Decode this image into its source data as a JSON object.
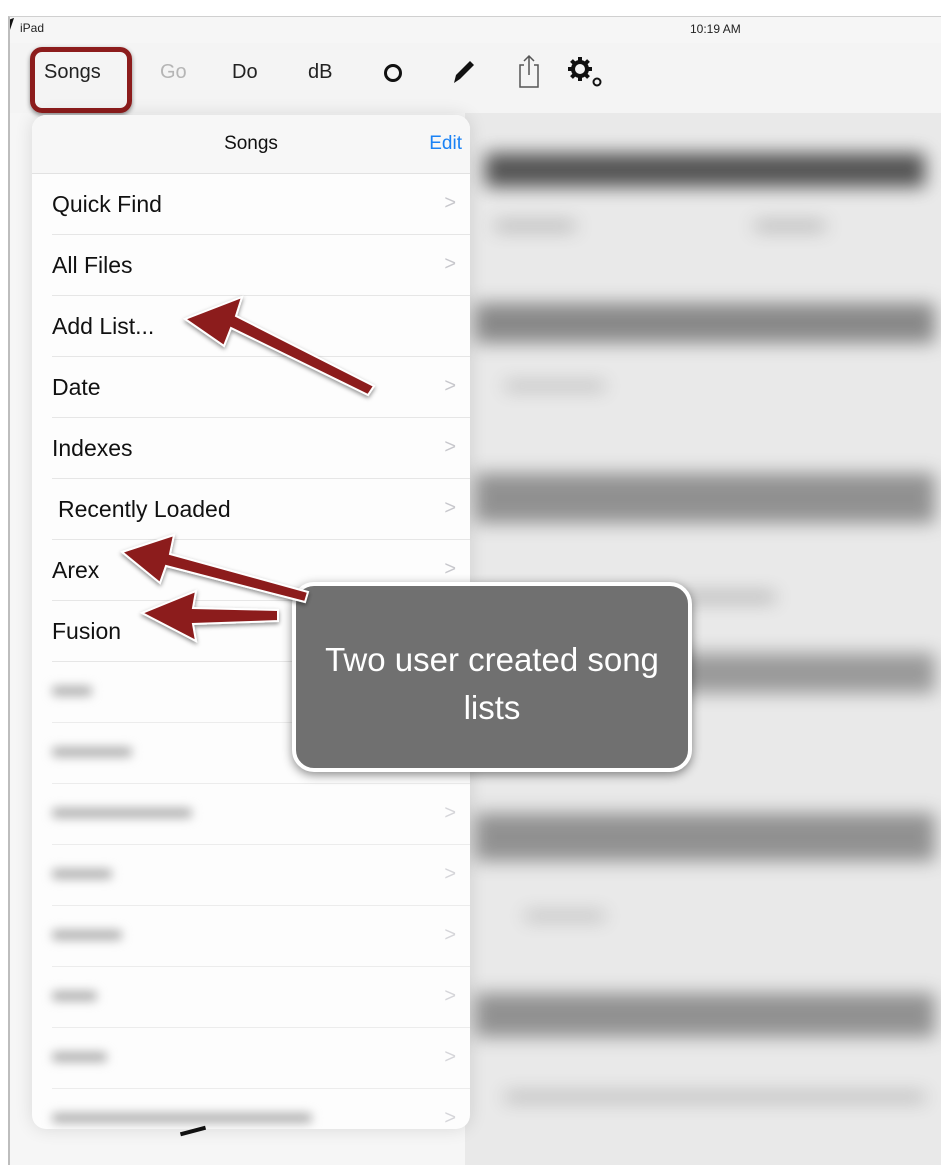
{
  "status_bar": {
    "carrier": "iPad",
    "time": "10:19 AM"
  },
  "toolbar": {
    "songs_label": "Songs",
    "go_label": "Go",
    "do_label": "Do",
    "db_label": "dB",
    "icons": [
      "record-icon",
      "pencil-icon",
      "share-icon",
      "settings-icon"
    ]
  },
  "popover": {
    "title": "Songs",
    "edit_label": "Edit",
    "rows": [
      {
        "label": "Quick Find"
      },
      {
        "label": "All Files"
      },
      {
        "label": "Add List..."
      },
      {
        "label": "Date"
      },
      {
        "label": "Indexes"
      },
      {
        "label": "Recently Loaded"
      },
      {
        "label": "Arex"
      },
      {
        "label": "Fusion"
      }
    ]
  },
  "callout": {
    "text": "Two user created song lists"
  },
  "colors": {
    "annotation_red": "#8c1c1c",
    "edit_blue": "#1a82f5",
    "callout_gray": "#707070"
  }
}
